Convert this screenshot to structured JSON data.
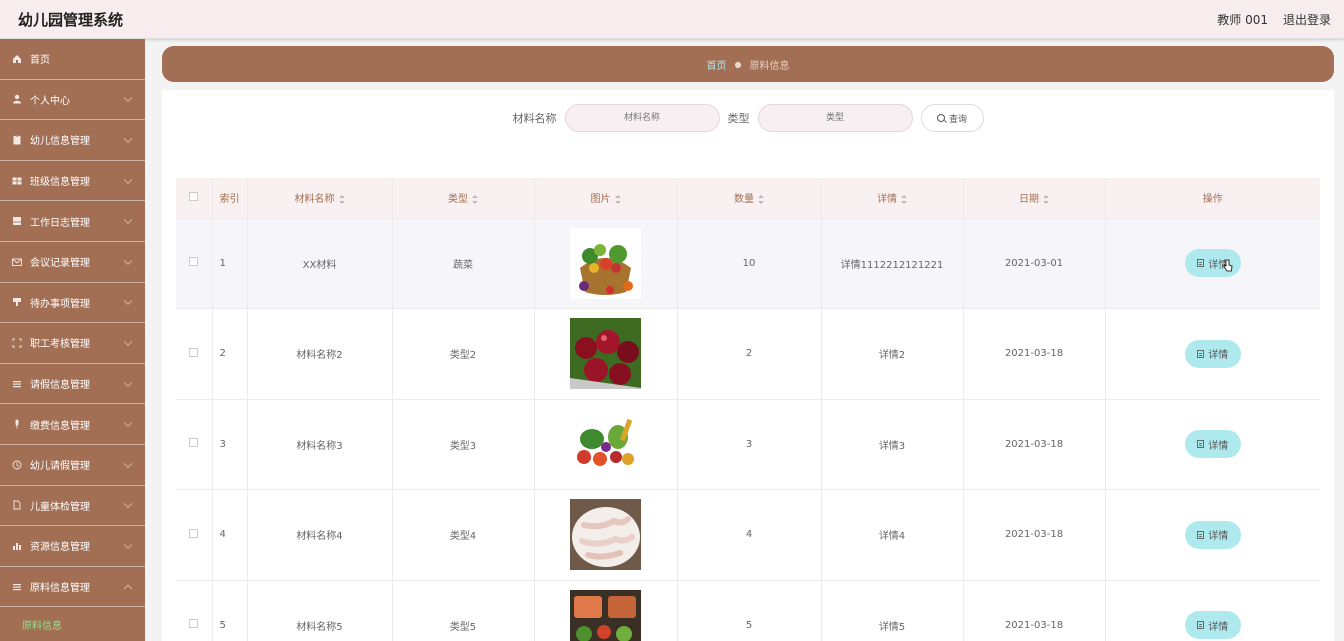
{
  "header": {
    "title": "幼儿园管理系统",
    "user": "教师 001",
    "logout": "退出登录"
  },
  "sidebar": {
    "items": [
      {
        "label": "首页",
        "icon": "home-icon",
        "has_children": false
      },
      {
        "label": "个人中心",
        "icon": "user-icon",
        "has_children": true
      },
      {
        "label": "幼儿信息管理",
        "icon": "clipboard-icon",
        "has_children": true
      },
      {
        "label": "班级信息管理",
        "icon": "grid-icon",
        "has_children": true
      },
      {
        "label": "工作日志管理",
        "icon": "book-icon",
        "has_children": true
      },
      {
        "label": "会议记录管理",
        "icon": "mail-icon",
        "has_children": true
      },
      {
        "label": "待办事项管理",
        "icon": "cup-icon",
        "has_children": true
      },
      {
        "label": "职工考核管理",
        "icon": "frame-icon",
        "has_children": true
      },
      {
        "label": "请假信息管理",
        "icon": "list-icon",
        "has_children": true
      },
      {
        "label": "缴费信息管理",
        "icon": "mic-icon",
        "has_children": true
      },
      {
        "label": "幼儿请假管理",
        "icon": "circle-icon",
        "has_children": true
      },
      {
        "label": "儿童体检管理",
        "icon": "doc-icon",
        "has_children": true
      },
      {
        "label": "资源信息管理",
        "icon": "chart-icon",
        "has_children": true
      },
      {
        "label": "原料信息管理",
        "icon": "list-icon",
        "has_children": true,
        "expanded": true
      }
    ],
    "submenu": [
      {
        "label": "原料信息",
        "active": true
      }
    ]
  },
  "breadcrumb": {
    "home": "首页",
    "separator": "●",
    "current": "原料信息"
  },
  "search": {
    "name_label": "材料名称",
    "name_placeholder": "材料名称",
    "type_label": "类型",
    "type_placeholder": "类型",
    "button": "查询"
  },
  "table": {
    "headers": [
      "索引",
      "材料名称",
      "类型",
      "图片",
      "数量",
      "详情",
      "日期",
      "操作"
    ],
    "action_label": "详情",
    "rows": [
      {
        "index": "1",
        "name": "XX材料",
        "type": "蔬菜",
        "image": "vegetable-basket",
        "qty": "10",
        "detail": "详情1112212121221",
        "date": "2021-03-01"
      },
      {
        "index": "2",
        "name": "材料名称2",
        "type": "类型2",
        "image": "cherries",
        "qty": "2",
        "detail": "详情2",
        "date": "2021-03-18"
      },
      {
        "index": "3",
        "name": "材料名称3",
        "type": "类型3",
        "image": "mixed-vegetables",
        "qty": "3",
        "detail": "详情3",
        "date": "2021-03-18"
      },
      {
        "index": "4",
        "name": "材料名称4",
        "type": "类型4",
        "image": "chicken-feet",
        "qty": "4",
        "detail": "详情4",
        "date": "2021-03-18"
      },
      {
        "index": "5",
        "name": "材料名称5",
        "type": "类型5",
        "image": "salmon-dish",
        "qty": "5",
        "detail": "详情5",
        "date": "2021-03-18"
      }
    ]
  },
  "colors": {
    "sidebar": "#a36f54",
    "accent_button": "#aee9ee",
    "active_submenu": "#8fe08f",
    "header_bg": "#f7ecee"
  }
}
